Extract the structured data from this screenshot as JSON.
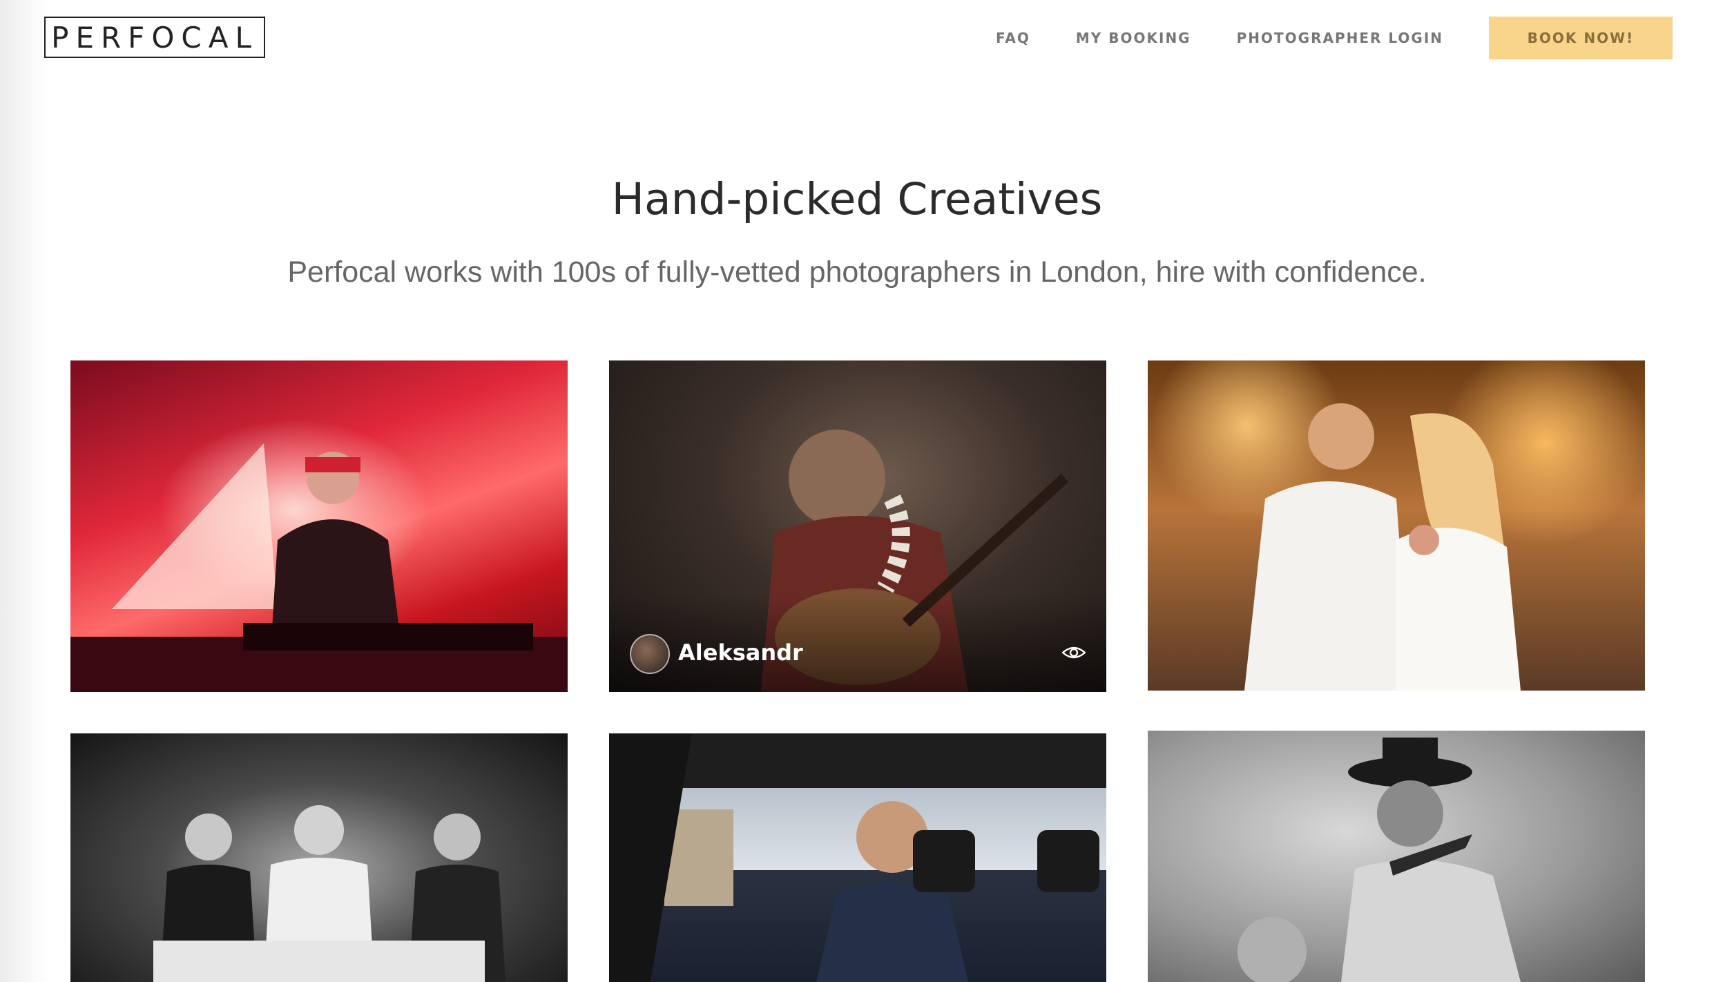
{
  "brand": {
    "logo_text": "PERFOCAL"
  },
  "nav": {
    "links": [
      "FAQ",
      "MY BOOKING",
      "PHOTOGRAPHER LOGIN"
    ],
    "cta_label": "BOOK NOW!"
  },
  "hero": {
    "title": "Hand-picked Creatives",
    "subtitle": "Perfocal works with 100s of fully-vetted photographers in London, hire with confidence."
  },
  "gallery": {
    "featured": {
      "name": "Aleksandr",
      "icon": "eye-icon"
    },
    "photos": [
      "dj-performing-red-stage",
      "guitarist-performing",
      "couple-kissing-sunset",
      "party-guests-black-white",
      "man-in-car-window",
      "violinist-black-white"
    ]
  },
  "colors": {
    "cta_background": "#f8d58a",
    "cta_text": "#8a6e3b",
    "nav_text": "#777777",
    "heading_text": "#2b2b2b"
  }
}
